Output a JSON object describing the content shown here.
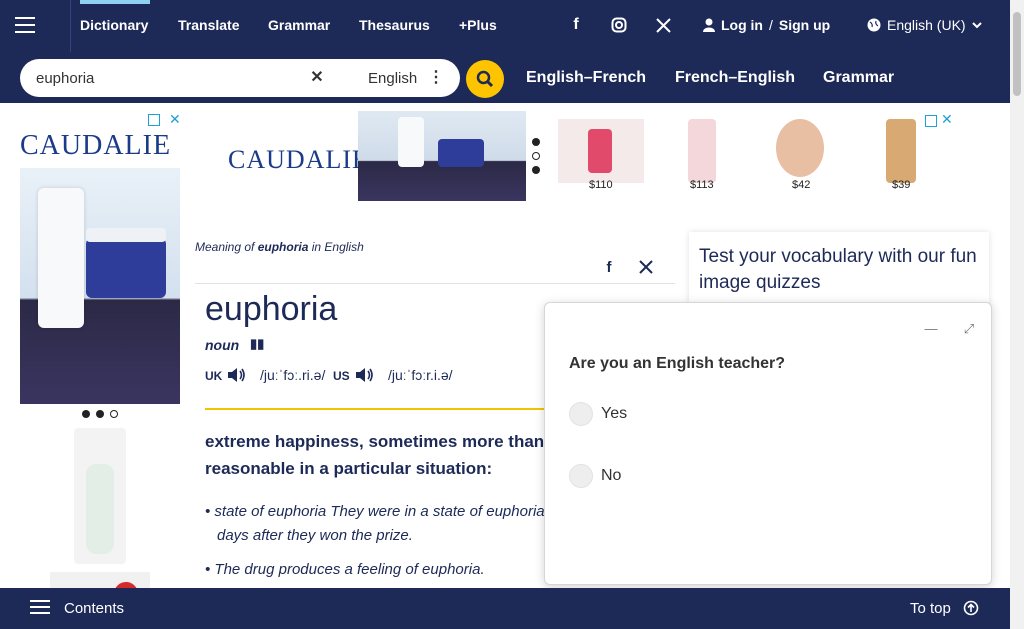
{
  "nav": {
    "links": [
      "Dictionary",
      "Translate",
      "Grammar",
      "Thesaurus",
      "+Plus"
    ],
    "login": "Log in",
    "slash": "/",
    "signup": "Sign up",
    "language": "English (UK)"
  },
  "search": {
    "value": "euphoria",
    "dictionary": "English"
  },
  "dict_tabs": [
    "English–French",
    "French–English",
    "Grammar"
  ],
  "ads": {
    "brand": "CAUDALIE",
    "prices": [
      "$110",
      "$113",
      "$42",
      "$39"
    ]
  },
  "entry": {
    "meaning_prefix": "Meaning of",
    "meaning_word": "euphoria",
    "meaning_suffix": "in English",
    "headword": "euphoria",
    "pos": "noun",
    "uk_label": "UK",
    "us_label": "US",
    "uk_ipa": "/juːˈfɔː.ri.ə/",
    "us_ipa": "/juːˈfɔːr.i.ə/",
    "definition_line1": "extreme happiness, sometimes more than is",
    "definition_line2": "reasonable in a particular situation:",
    "examples": [
      "state of euphoria They were in a state of euphoria for",
      "days after they won the prize.",
      "The drug produces a feeling of euphoria."
    ]
  },
  "quiz_card": {
    "title": "Test your vocabulary with our fun image quizzes"
  },
  "popup": {
    "question": "Are you an English teacher?",
    "options": [
      "Yes",
      "No"
    ]
  },
  "bottom": {
    "contents": "Contents",
    "to_top": "To top"
  },
  "colors": {
    "navy": "#1d2a57",
    "yellow": "#fec400",
    "accent": "#8fd1f0"
  }
}
